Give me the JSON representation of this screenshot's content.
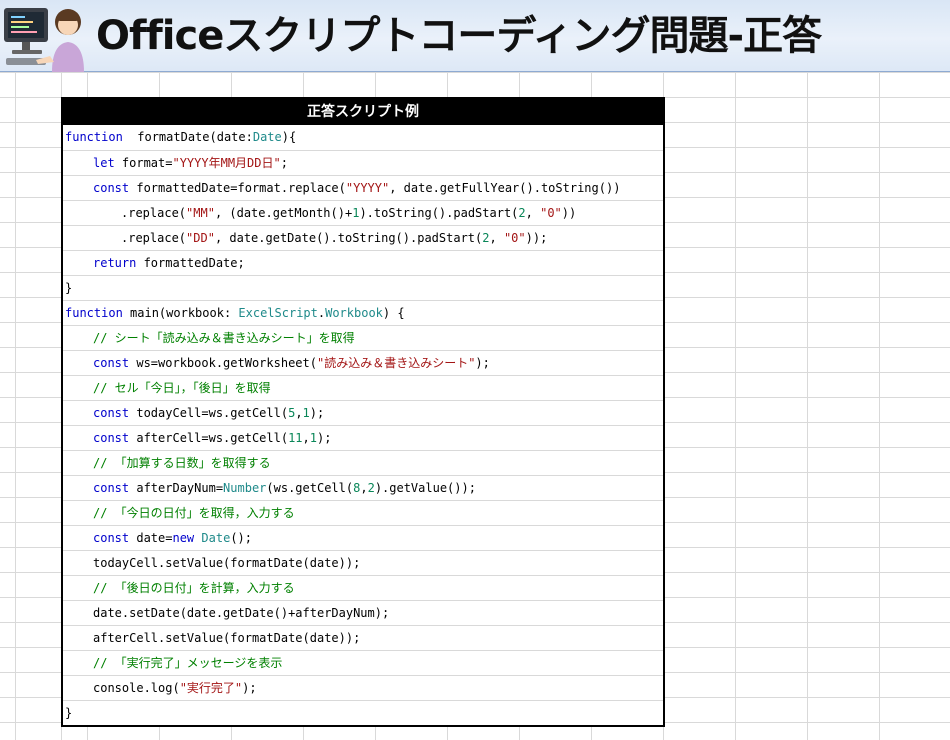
{
  "banner": {
    "title": "Officeスクリプトコーディング問題-正答"
  },
  "code": {
    "header": "正答スクリプト例",
    "lines": [
      {
        "indent": 0,
        "parts": [
          [
            "k",
            "function"
          ],
          [
            "",
            "  formatDate(date:"
          ],
          [
            "t",
            "Date"
          ],
          [
            "",
            "){"
          ]
        ]
      },
      {
        "indent": 1,
        "parts": [
          [
            "k",
            "let"
          ],
          [
            "",
            " format="
          ],
          [
            "s",
            "\"YYYY年MM月DD日\""
          ],
          [
            "",
            ";"
          ]
        ]
      },
      {
        "indent": 1,
        "parts": [
          [
            "k",
            "const"
          ],
          [
            "",
            " formattedDate=format.replace("
          ],
          [
            "s",
            "\"YYYY\""
          ],
          [
            "",
            ", date.getFullYear().toString())"
          ]
        ]
      },
      {
        "indent": 2,
        "parts": [
          [
            "",
            ".replace("
          ],
          [
            "s",
            "\"MM\""
          ],
          [
            "",
            ", (date.getMonth()+"
          ],
          [
            "n",
            "1"
          ],
          [
            "",
            ").toString().padStart("
          ],
          [
            "n",
            "2"
          ],
          [
            "",
            ", "
          ],
          [
            "s",
            "\"0\""
          ],
          [
            "",
            "))"
          ]
        ]
      },
      {
        "indent": 2,
        "parts": [
          [
            "",
            ".replace("
          ],
          [
            "s",
            "\"DD\""
          ],
          [
            "",
            ", date.getDate().toString().padStart("
          ],
          [
            "n",
            "2"
          ],
          [
            "",
            ", "
          ],
          [
            "s",
            "\"0\""
          ],
          [
            "",
            "));"
          ]
        ]
      },
      {
        "indent": 1,
        "parts": [
          [
            "k",
            "return"
          ],
          [
            "",
            " formattedDate;"
          ]
        ]
      },
      {
        "indent": 0,
        "parts": [
          [
            "",
            "}"
          ]
        ]
      },
      {
        "indent": 0,
        "parts": [
          [
            "k",
            "function"
          ],
          [
            "",
            " main(workbook: "
          ],
          [
            "t",
            "ExcelScript"
          ],
          [
            "",
            "."
          ],
          [
            "t",
            "Workbook"
          ],
          [
            "",
            ") {"
          ]
        ]
      },
      {
        "indent": 1,
        "parts": [
          [
            "c",
            "// シート「読み込み＆書き込みシート」を取得"
          ]
        ]
      },
      {
        "indent": 1,
        "parts": [
          [
            "k",
            "const"
          ],
          [
            "",
            " ws=workbook.getWorksheet("
          ],
          [
            "s",
            "\"読み込み＆書き込みシート\""
          ],
          [
            "",
            ");"
          ]
        ]
      },
      {
        "indent": 1,
        "parts": [
          [
            "c",
            "// セル「今日」，「後日」を取得"
          ]
        ]
      },
      {
        "indent": 1,
        "parts": [
          [
            "k",
            "const"
          ],
          [
            "",
            " todayCell=ws.getCell("
          ],
          [
            "n",
            "5"
          ],
          [
            "",
            ","
          ],
          [
            "n",
            "1"
          ],
          [
            "",
            ");"
          ]
        ]
      },
      {
        "indent": 1,
        "parts": [
          [
            "k",
            "const"
          ],
          [
            "",
            " afterCell=ws.getCell("
          ],
          [
            "n",
            "11"
          ],
          [
            "",
            ","
          ],
          [
            "n",
            "1"
          ],
          [
            "",
            ");"
          ]
        ]
      },
      {
        "indent": 1,
        "parts": [
          [
            "c",
            "// 「加算する日数」を取得する"
          ]
        ]
      },
      {
        "indent": 1,
        "parts": [
          [
            "k",
            "const"
          ],
          [
            "",
            " afterDayNum="
          ],
          [
            "t",
            "Number"
          ],
          [
            "",
            "(ws.getCell("
          ],
          [
            "n",
            "8"
          ],
          [
            "",
            ","
          ],
          [
            "n",
            "2"
          ],
          [
            "",
            ").getValue());"
          ]
        ]
      },
      {
        "indent": 1,
        "parts": [
          [
            "c",
            "// 「今日の日付」を取得，入力する"
          ]
        ]
      },
      {
        "indent": 1,
        "parts": [
          [
            "k",
            "const"
          ],
          [
            "",
            " date="
          ],
          [
            "k",
            "new"
          ],
          [
            "",
            " "
          ],
          [
            "t",
            "Date"
          ],
          [
            "",
            "();"
          ]
        ]
      },
      {
        "indent": 1,
        "parts": [
          [
            "",
            "todayCell.setValue(formatDate(date));"
          ]
        ]
      },
      {
        "indent": 1,
        "parts": [
          [
            "c",
            "// 「後日の日付」を計算，入力する"
          ]
        ]
      },
      {
        "indent": 1,
        "parts": [
          [
            "",
            "date.setDate(date.getDate()+afterDayNum);"
          ]
        ]
      },
      {
        "indent": 1,
        "parts": [
          [
            "",
            "afterCell.setValue(formatDate(date));"
          ]
        ]
      },
      {
        "indent": 1,
        "parts": [
          [
            "c",
            "// 「実行完了」メッセージを表示"
          ]
        ]
      },
      {
        "indent": 1,
        "parts": [
          [
            "",
            "console.log("
          ],
          [
            "s",
            "\"実行完了\""
          ],
          [
            "",
            ");"
          ]
        ]
      },
      {
        "indent": 0,
        "parts": [
          [
            "",
            "}"
          ]
        ]
      }
    ]
  }
}
